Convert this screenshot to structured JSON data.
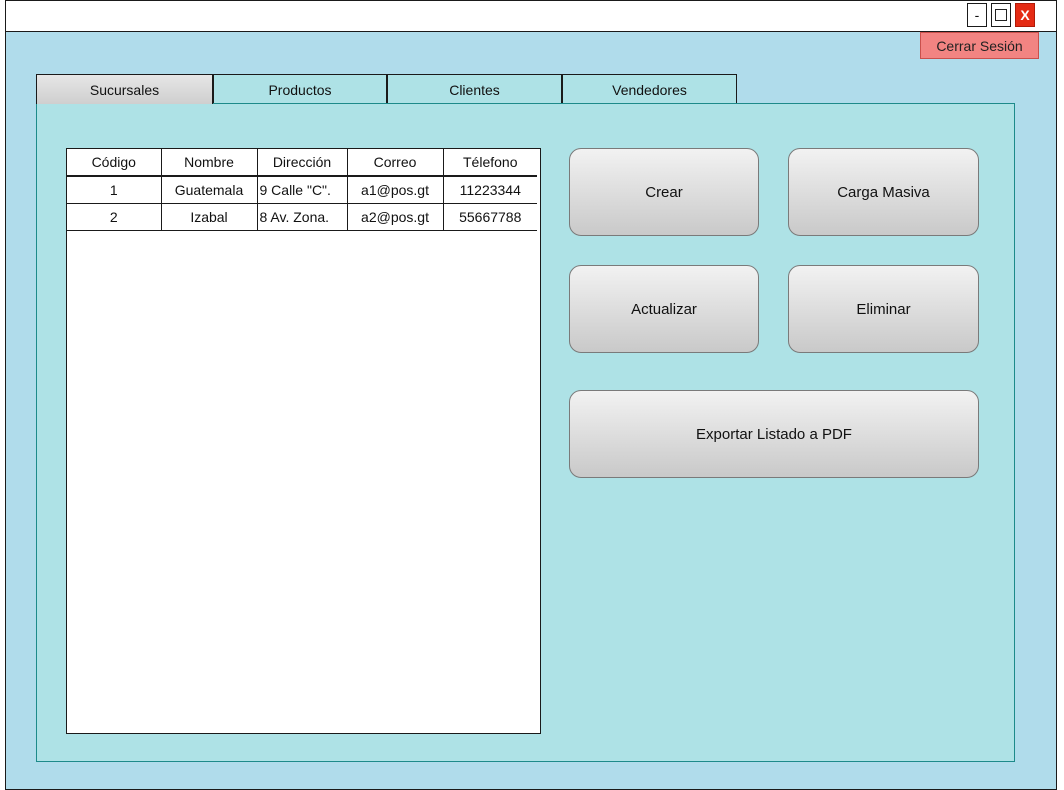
{
  "window": {
    "controls": {
      "minimize": "-",
      "close": "X"
    }
  },
  "header": {
    "logout_label": "Cerrar Sesión"
  },
  "tabs": [
    {
      "label": "Sucursales",
      "active": true
    },
    {
      "label": "Productos",
      "active": false
    },
    {
      "label": "Clientes",
      "active": false
    },
    {
      "label": "Vendedores",
      "active": false
    }
  ],
  "table": {
    "columns": [
      "Código",
      "Nombre",
      "Dirección",
      "Correo",
      "Télefono"
    ],
    "rows": [
      [
        "1",
        "Guatemala",
        "9 Calle \"C\".",
        "a1@pos.gt",
        "11223344"
      ],
      [
        "2",
        "Izabal",
        "8 Av. Zona.",
        "a2@pos.gt",
        "55667788"
      ]
    ]
  },
  "actions": {
    "create": "Crear",
    "bulk_load": "Carga Masiva",
    "update": "Actualizar",
    "delete": "Eliminar",
    "export_pdf": "Exportar Listado a PDF"
  },
  "colors": {
    "window_bg": "#b0dceb",
    "panel_bg": "#aee2e6",
    "close_button": "#e52b14",
    "logout_button": "#f28482"
  }
}
